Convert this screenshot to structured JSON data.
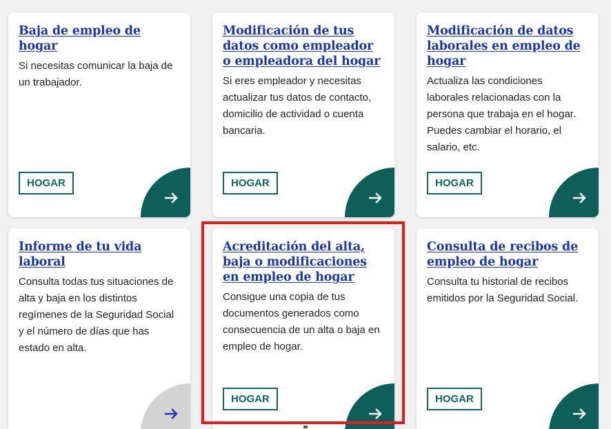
{
  "cards": [
    {
      "title": "Baja de empleo de hogar",
      "description": "Si necesitas comunicar la baja de un trabajador.",
      "tag": "HOGAR",
      "arrow_enabled": true
    },
    {
      "title": "Modificación de tus datos como empleador o empleadora del hogar",
      "description": "Si eres empleador y necesitas actualizar tus datos de contacto, domicilio de actividad o cuenta bancaria.",
      "tag": "HOGAR",
      "arrow_enabled": true
    },
    {
      "title": "Modificación de datos laborales en empleo de hogar",
      "description": "Actualiza las condiciones laborales relacionadas con la persona que trabaja en el hogar. Puedes cambiar el horario, el salario, etc.",
      "tag": "HOGAR",
      "arrow_enabled": true
    },
    {
      "title": "Informe de tu vida laboral",
      "description": "Consulta todas tus situaciones de alta y baja en los distintos regímenes de la Seguridad Social y el número de días que has estado en alta.",
      "tag": "",
      "arrow_enabled": false
    },
    {
      "title": "Acreditación del alta, baja o modificaciones en empleo de hogar",
      "description": "Consigue una copia de tus documentos generados como consecuencia de un alta o baja en empleo de hogar.",
      "tag": "HOGAR",
      "arrow_enabled": true
    },
    {
      "title": "Consulta de recibos de empleo de hogar",
      "description": "Consulta tu historial de recibos emitidos por la Seguridad Social.",
      "tag": "HOGAR",
      "arrow_enabled": true
    }
  ],
  "icons": {
    "card_arrow": "arrow-right-icon"
  },
  "colors": {
    "title_link": "#1a37a8",
    "accent_teal": "#0e5f5a",
    "tag_border": "#0e6661",
    "disabled_corner": "#d3d3d3",
    "highlight": "#e41b1b"
  }
}
